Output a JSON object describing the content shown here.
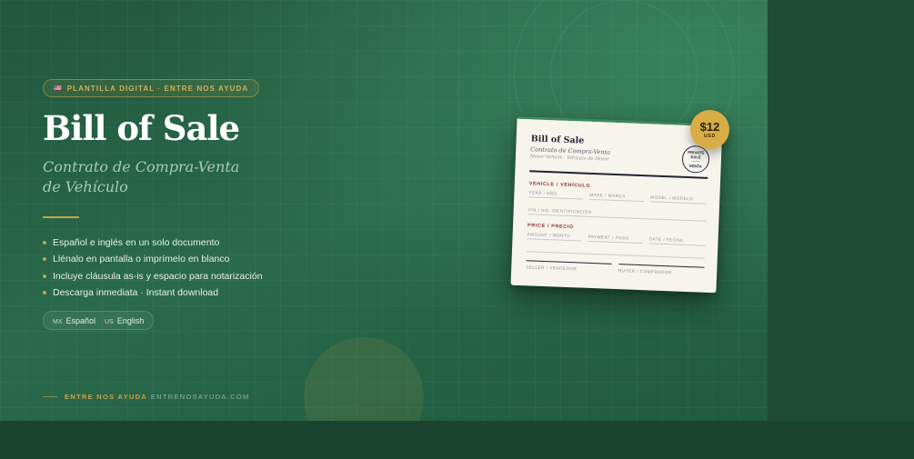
{
  "badge": {
    "flag_text": "🇺🇸",
    "label": "PLANTILLA DIGITAL · ENTRE NOS AYUDA"
  },
  "hero": {
    "title": "Bill of Sale",
    "subtitle_line1": "Contrato de Compra-Venta",
    "subtitle_line2": "de Vehículo"
  },
  "features": [
    "Español e inglés en un solo documento",
    "Llénalo en pantalla o imprímelo en blanco",
    "Incluye cláusula as-is y espacio para notarización",
    "Descarga inmediata · Instant download"
  ],
  "languages": [
    {
      "code": "MX",
      "label": "Español"
    },
    {
      "code": "US",
      "label": "English"
    }
  ],
  "footer": {
    "brand": "ENTRE NOS AYUDA",
    "separator": " · ",
    "domain": "ENTRENOSAYUDA.COM"
  },
  "document": {
    "title": "Bill of Sale",
    "subtitle": "Contrato de Compra-Venta",
    "subtitle2": "Motor Vehicle · Vehículo de Motor",
    "stamp": {
      "top": "PRIVATE",
      "line2": "SALE",
      "mid": "———",
      "bottom": "VENTA"
    },
    "vehicle_section": "VEHICLE / VEHÍCULO",
    "vehicle_fields": [
      "YEAR / AÑO",
      "MAKE / MARCA",
      "MODEL / MODELO"
    ],
    "vin_field": "VIN / NO. IDENTIFICACIÓN",
    "price_section": "PRICE / PRECIO",
    "price_fields": [
      "AMOUNT / MONTO",
      "PAYMENT / PAGO",
      "DATE / FECHA"
    ],
    "signatures": [
      "SELLER / VENDEDOR",
      "BUYER / COMPRADOR"
    ]
  },
  "price_badge": {
    "amount": "$12",
    "currency": "USD"
  },
  "colors": {
    "accent_gold": "#c9a24a",
    "background_green": "#2a6a4b",
    "section_red": "#8c2a30"
  }
}
